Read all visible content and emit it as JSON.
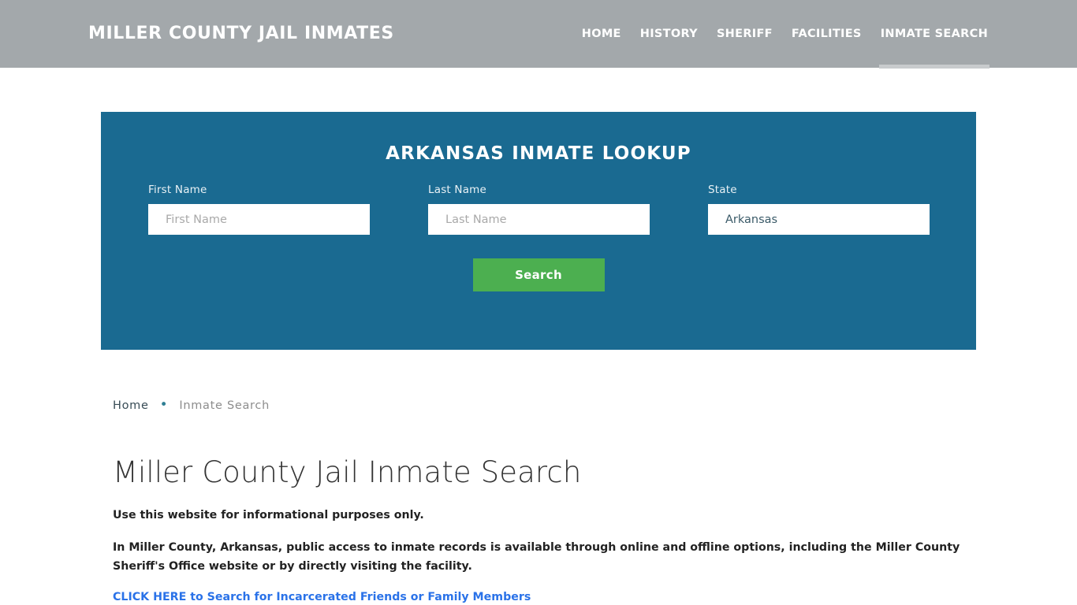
{
  "header": {
    "logo": "MILLER COUNTY JAIL INMATES",
    "nav": [
      {
        "label": "HOME",
        "active": false
      },
      {
        "label": "HISTORY",
        "active": false
      },
      {
        "label": "SHERIFF",
        "active": false
      },
      {
        "label": "FACILITIES",
        "active": false
      },
      {
        "label": "INMATE SEARCH",
        "active": true
      }
    ],
    "background_color": "#a3a8ab",
    "active_underline_color": "#c8cbcd"
  },
  "lookup": {
    "title": "ARKANSAS INMATE LOOKUP",
    "panel_color": "#1a6a91",
    "fields": {
      "first_name": {
        "label": "First Name",
        "placeholder": "First Name",
        "value": ""
      },
      "last_name": {
        "label": "Last Name",
        "placeholder": "Last Name",
        "value": ""
      },
      "state": {
        "label": "State",
        "selected": "Arkansas",
        "options": [
          "Arkansas"
        ]
      }
    },
    "search_button": {
      "label": "Search",
      "color": "#4caf50"
    }
  },
  "breadcrumb": {
    "home": "Home",
    "separator": "•",
    "current": "Inmate Search"
  },
  "main": {
    "title": "Miller County Jail Inmate Search",
    "lead": "Use this website for informational purposes only.",
    "paragraph": "In Miller County, Arkansas, public access to inmate records is available through online and offline options, including the Miller County Sheriff's Office website or by directly visiting the facility.",
    "cta_link": "CLICK HERE to Search for Incarcerated Friends or Family Members",
    "cta_color": "#2a72e8"
  }
}
